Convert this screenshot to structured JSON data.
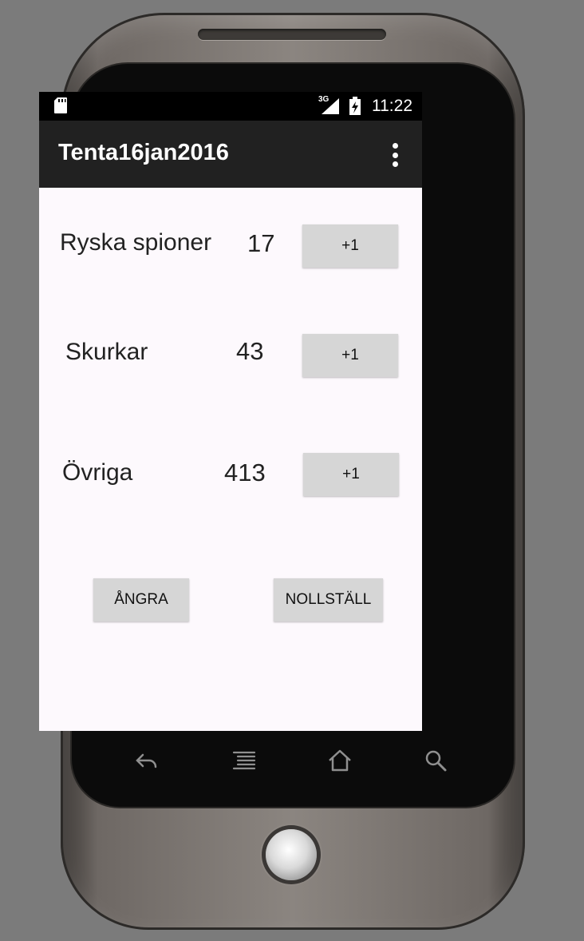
{
  "status_bar": {
    "network": "3G",
    "time": "11:22"
  },
  "app_bar": {
    "title": "Tenta16jan2016"
  },
  "counters": [
    {
      "label": "Ryska spioner",
      "count": "17",
      "button": "+1"
    },
    {
      "label": "Skurkar",
      "count": "43",
      "button": "+1"
    },
    {
      "label": "Övriga",
      "count": "413",
      "button": "+1"
    }
  ],
  "actions": {
    "undo_label": "ÅNGRA",
    "reset_label": "NOLLSTÄLL"
  },
  "icons": {
    "sd": "sd-card-icon",
    "signal": "signal-icon",
    "battery": "battery-charging-icon",
    "overflow": "overflow-menu-icon",
    "back": "back-icon",
    "menu": "menu-icon",
    "home": "home-icon",
    "search": "search-icon"
  },
  "colors": {
    "status_bar": "#000000",
    "app_bar": "#212121",
    "screen_bg": "#fdf9fd",
    "button_bg": "#d6d6d6"
  }
}
